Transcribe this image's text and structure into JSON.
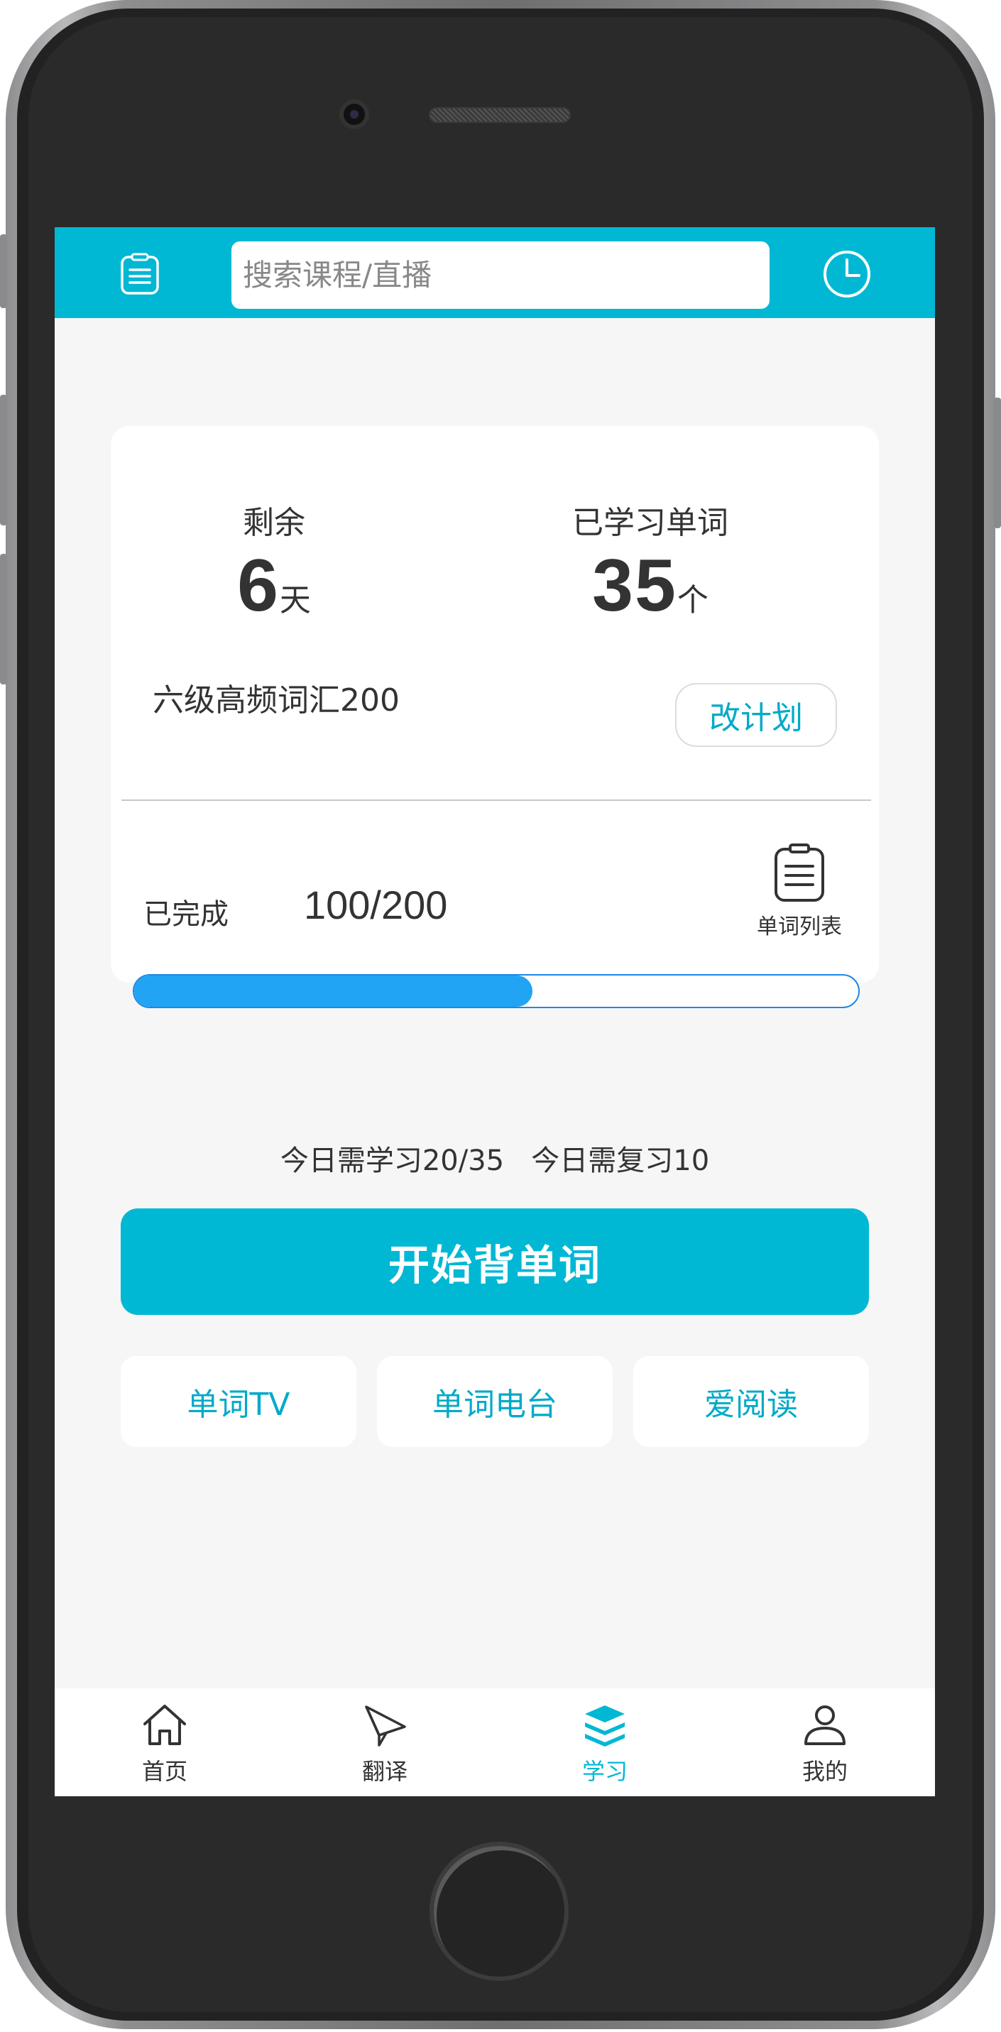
{
  "header": {
    "search_placeholder": "搜索课程/直播",
    "menu_icon": "clipboard-icon",
    "history_icon": "clock-icon"
  },
  "plan": {
    "remaining_label": "剩余",
    "remaining_value": "6",
    "remaining_unit": "天",
    "learned_label": "已学习单词",
    "learned_value": "35",
    "learned_unit": "个",
    "book_name": "六级高频词汇200",
    "change_plan_label": "改计划",
    "completed_label": "已完成",
    "completed_value": "100/200",
    "progress_fraction": 0.55,
    "word_list_label": "单词列表"
  },
  "today": {
    "summary": "今日需学习20/35   今日需复习10"
  },
  "start_button_label": "开始背单词",
  "features": [
    {
      "label": "单词TV"
    },
    {
      "label": "单词电台"
    },
    {
      "label": "爱阅读"
    }
  ],
  "nav": [
    {
      "label": "首页",
      "icon": "home-icon"
    },
    {
      "label": "翻译",
      "icon": "paper-plane-icon"
    },
    {
      "label": "学习",
      "icon": "layers-icon",
      "active": true
    },
    {
      "label": "我的",
      "icon": "user-icon"
    }
  ],
  "colors": {
    "accent": "#00b8d4",
    "progress": "#20a4f3",
    "background": "#f6f6f6"
  }
}
